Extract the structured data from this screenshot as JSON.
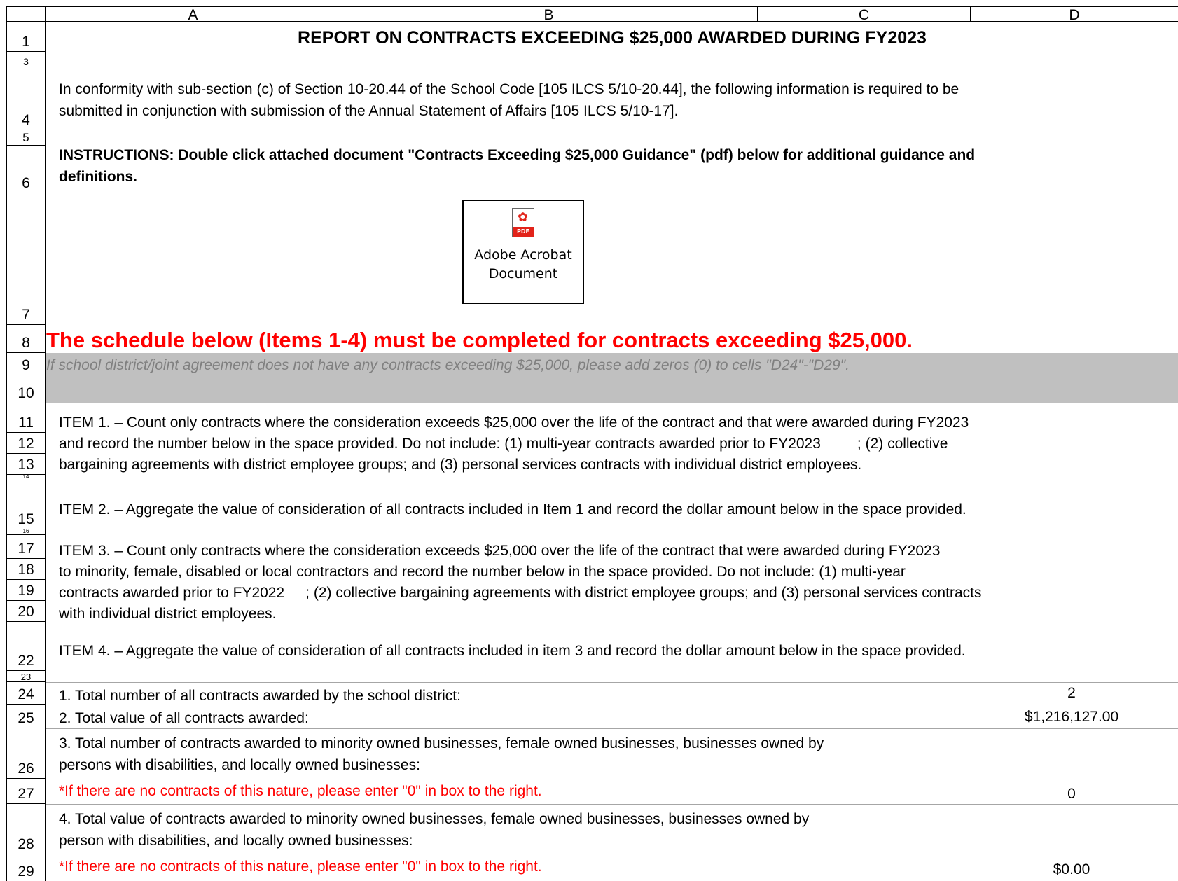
{
  "columns": [
    "A",
    "B",
    "C",
    "D"
  ],
  "rows": [
    "1",
    "3",
    "4",
    "5",
    "6",
    "7",
    "8",
    "9",
    "10",
    "11",
    "12",
    "13",
    "14",
    "15",
    "16",
    "17",
    "18",
    "19",
    "20",
    "22",
    "23",
    "24",
    "25",
    "26",
    "27",
    "28",
    "29"
  ],
  "title": "REPORT ON CONTRACTS EXCEEDING $25,000 AWARDED DURING FY2023",
  "intro": {
    "line1": "In conformity with sub-section (c) of Section 10-20.44 of the School Code [105 ILCS 5/10-20.44], the following information is required to be",
    "line2": "submitted in conjunction with submission of the Annual Statement of Affairs [105 ILCS 5/10-17]."
  },
  "instructions": {
    "line1": "INSTRUCTIONS:  Double click attached document \"Contracts Exceeding $25,000 Guidance\" (pdf) below for additional guidance and",
    "line2": "definitions."
  },
  "attachment": {
    "icon": "pdf-icon",
    "icon_badge": "PDF",
    "line1": "Adobe Acrobat",
    "line2": "Document"
  },
  "schedule_notice": "The schedule below (Items 1-4) must be completed for contracts exceeding $25,000.",
  "zero_notice": "If school district/joint agreement does not have any contracts exceeding $25,000, please add zeros (0) to cells \"D24\"-\"D29\".",
  "items": {
    "item1_l1": "ITEM 1. – Count only contracts where the consideration exceeds $25,000 over the life of the contract and that were awarded during FY2023",
    "item1_l2a": "and record the number below in the space provided. Do not include: (1) multi-year contracts awarded prior to FY2023",
    "item1_l2b": "; (2) collective",
    "item1_l3": "bargaining agreements with district employee groups; and (3) personal services contracts with individual district employees.",
    "item2": "ITEM 2. – Aggregate the value of consideration of all contracts included in Item 1 and record the dollar amount below in the space provided.",
    "item3_l1": "ITEM 3. – Count only contracts where the consideration exceeds $25,000 over the life of the contract that were awarded during FY2023",
    "item3_l2": "to minority, female, disabled or local contractors and record the number below in the space provided. Do not include: (1) multi-year",
    "item3_l3a": "contracts awarded prior to FY2022",
    "item3_l3b": "; (2) collective bargaining agreements with district employee groups; and (3) personal services contracts",
    "item3_l4": "with individual district employees.",
    "item4": "ITEM 4. – Aggregate the value of consideration of all contracts included in item 3 and record the dollar amount below in the space provided."
  },
  "summary": {
    "r24_label": "1.  Total number of all contracts awarded by the school district:",
    "r24_value": "2",
    "r25_label": "2.  Total value of all contracts awarded:",
    "r25_value": "$1,216,127.00",
    "r26_l1": "3.  Total number of contracts awarded to minority owned businesses, female owned businesses, businesses owned by",
    "r26_l2": "persons with disabilities, and locally owned businesses:",
    "r27_note": "*If there are no contracts of this nature, please enter \"0\" in box to the right.",
    "r27_value": "0",
    "r28_l1": "4.  Total value of contracts awarded to minority owned businesses, female owned businesses, businesses owned by",
    "r28_l2": "person with disabilities, and locally owned businesses:",
    "r29_note": "*If there are no contracts of this nature, please enter \"0\" in box to the right.",
    "r29_value": "$0.00"
  }
}
